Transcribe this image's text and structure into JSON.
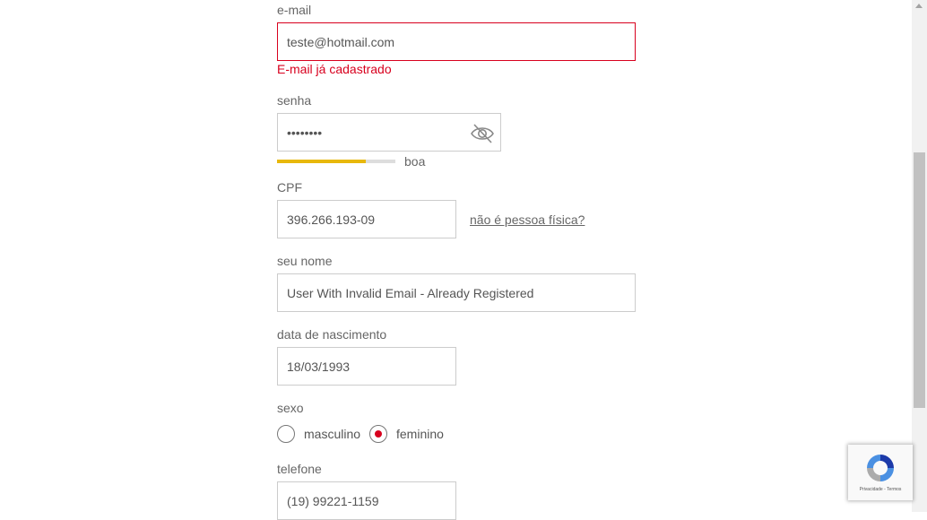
{
  "form": {
    "email": {
      "label": "e-mail",
      "value": "teste@hotmail.com",
      "error": "E-mail já cadastrado"
    },
    "password": {
      "label": "senha",
      "value": "••••••••",
      "strength_label": "boa",
      "strength_level": 0.75,
      "icon": "eye-slash-icon"
    },
    "cpf": {
      "label": "CPF",
      "value": "396.266.193-09",
      "link": "não é pessoa física?"
    },
    "name": {
      "label": "seu nome",
      "value": "User With Invalid Email - Already Registered"
    },
    "birthdate": {
      "label": "data de nascimento",
      "value": "18/03/1993"
    },
    "gender": {
      "label": "sexo",
      "options": [
        {
          "label": "masculino",
          "selected": false
        },
        {
          "label": "feminino",
          "selected": true
        }
      ]
    },
    "phone": {
      "label": "telefone",
      "value": "(19) 99221-1159"
    }
  },
  "recaptcha": {
    "terms": "Privacidade - Termos"
  },
  "colors": {
    "error": "#d8001e",
    "strength": "#e8b80c",
    "border": "#cccccc"
  }
}
